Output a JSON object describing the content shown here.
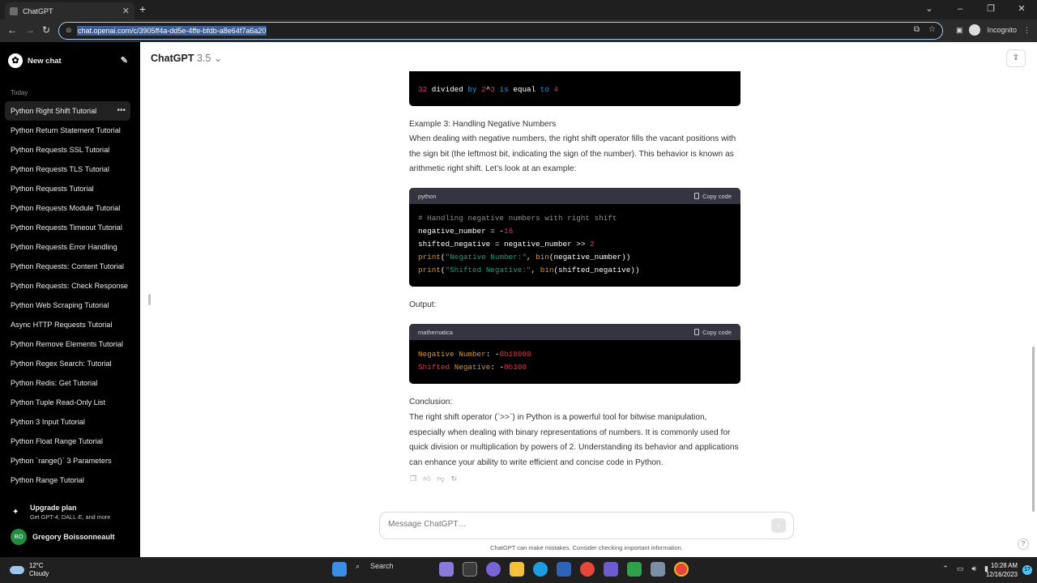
{
  "browser": {
    "tab_title": "ChatGPT",
    "url": "chat.openai.com/c/3905ff4a-dd5e-4ffe-bfdb-a8e64f7a6a20",
    "profile_label": "Incognito"
  },
  "sidebar": {
    "new_chat": "New chat",
    "section": "Today",
    "items": [
      "Python Right Shift Tutorial",
      "Python Return Statement Tutorial",
      "Python Requests SSL Tutorial",
      "Python Requests TLS Tutorial",
      "Python Requests Tutorial",
      "Python Requests Module Tutorial",
      "Python Requests Timeout Tutorial",
      "Python Requests Error Handling",
      "Python Requests: Content Tutorial",
      "Python Requests: Check Response",
      "Python Web Scraping Tutorial",
      "Async HTTP Requests Tutorial",
      "Python Remove Elements Tutorial",
      "Python Regex Search: Tutorial",
      "Python Redis: Get Tutorial",
      "Python Tuple Read-Only List",
      "Python 3 Input Tutorial",
      "Python Float Range Tutorial",
      "Python `range()` 3 Parameters",
      "Python Range Tutorial"
    ],
    "upgrade_title": "Upgrade plan",
    "upgrade_sub": "Get GPT-4, DALL·E, and more",
    "user_initials": "BO",
    "user_name": "Gregory Boissonneault"
  },
  "header": {
    "model": "ChatGPT",
    "version": "3.5"
  },
  "conversation": {
    "prev_code_line": "32 divided by 2^3 is equal to 4",
    "example_heading": "Example 3: Handling Negative Numbers",
    "example_text": "When dealing with negative numbers, the right shift operator fills the vacant positions with the sign bit (the leftmost bit, indicating the sign of the number). This behavior is known as arithmetic right shift. Let's look at an example:",
    "code1_lang": "python",
    "copy_label": "Copy code",
    "output_label": "Output:",
    "code2_lang": "mathematica",
    "conclusion_heading": "Conclusion:",
    "conclusion_text": "The right shift operator (`>>`) in Python is a powerful tool for bitwise manipulation, especially when dealing with binary representations of numbers. It is commonly used for quick division or multiplication by powers of 2. Understanding its behavior and applications can enhance your ability to write efficient and concise code in Python."
  },
  "composer": {
    "placeholder": "Message ChatGPT…",
    "disclaimer": "ChatGPT can make mistakes. Consider checking important information."
  },
  "taskbar": {
    "temp": "12°C",
    "weather": "Cloudy",
    "search": "Search",
    "time": "10:28 AM",
    "date": "12/16/2023",
    "notif_count": "17"
  }
}
